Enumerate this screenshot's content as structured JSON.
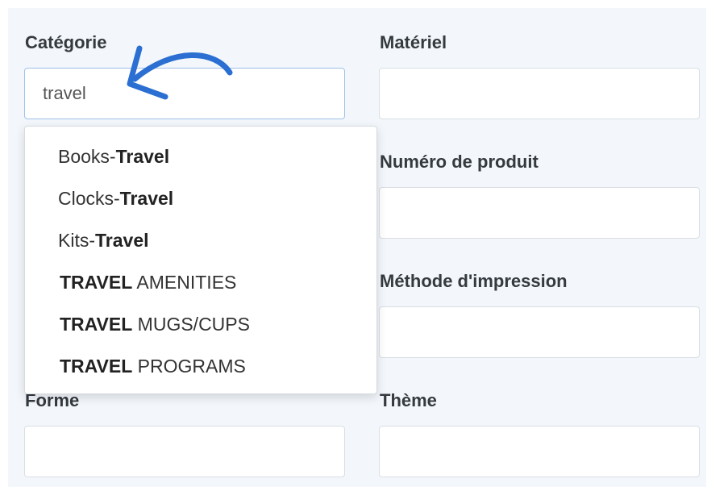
{
  "form": {
    "categorie_label": "Catégorie",
    "categorie_value": "travel",
    "materiel_label": "Matériel",
    "numero_label": "Numéro de produit",
    "methode_label": "Méthode d'impression",
    "forme_label": "Forme",
    "theme_label": "Thème"
  },
  "suggestions": [
    {
      "prefix": "Books-",
      "match": "Travel",
      "suffix": ""
    },
    {
      "prefix": "Clocks-",
      "match": "Travel",
      "suffix": ""
    },
    {
      "prefix": "Kits-",
      "match": "Travel",
      "suffix": ""
    },
    {
      "prefix": "",
      "match": "TRAVEL",
      "suffix": " AMENITIES"
    },
    {
      "prefix": "",
      "match": "TRAVEL",
      "suffix": " MUGS/CUPS"
    },
    {
      "prefix": "",
      "match": "TRAVEL",
      "suffix": " PROGRAMS"
    }
  ],
  "colors": {
    "annotation_arrow": "#2a6fd1",
    "panel_background": "#f3f7fb",
    "focused_border": "#9ec1ea"
  },
  "annotation": {
    "icon": "curved-arrow-icon"
  }
}
